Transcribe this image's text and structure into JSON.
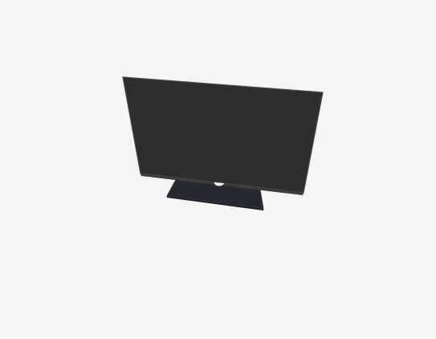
{
  "scene": {
    "object_icon": "tv-monitor-3d-icon",
    "colors": {
      "background": "#f5f5f5",
      "screen": "#2e2e2e",
      "bezel_edge": "#4a4a4a",
      "stand": "#262a2f",
      "stand_edge": "#3a4048",
      "mount_hole": "#f2f2f2"
    }
  }
}
